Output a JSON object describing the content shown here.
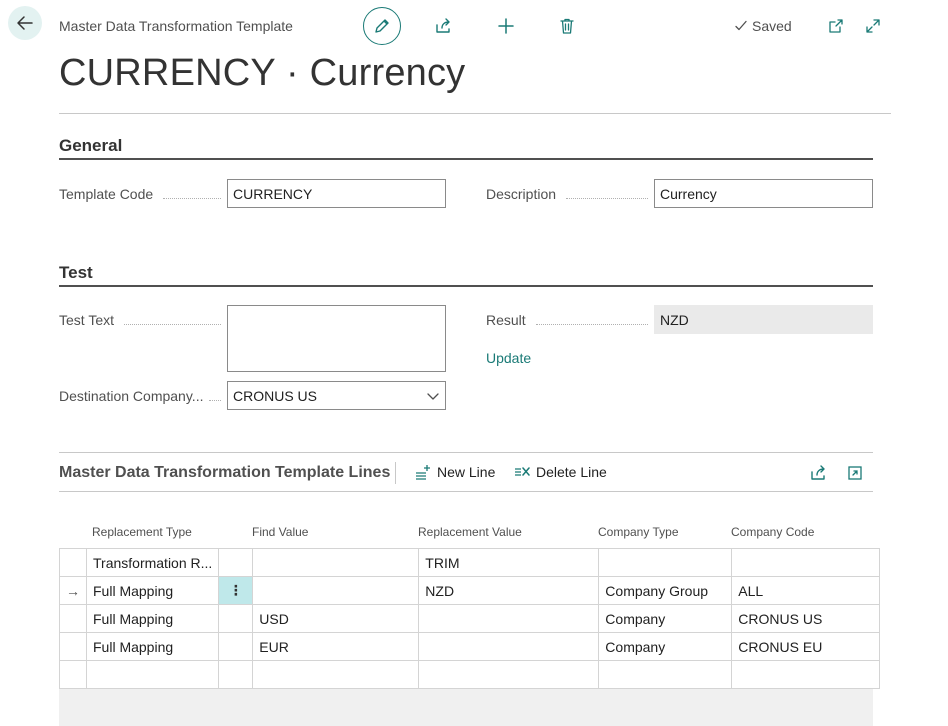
{
  "header": {
    "breadcrumb": "Master Data Transformation Template",
    "saved_label": "Saved",
    "title": "CURRENCY · Currency"
  },
  "general": {
    "heading": "General",
    "template_code_label": "Template Code",
    "template_code_value": "CURRENCY",
    "description_label": "Description",
    "description_value": "Currency"
  },
  "test": {
    "heading": "Test",
    "test_text_label": "Test Text",
    "test_text_value": "",
    "result_label": "Result",
    "result_value": "NZD",
    "update_label": "Update",
    "destination_label": "Destination Company...",
    "destination_value": "CRONUS US"
  },
  "lines": {
    "title": "Master Data Transformation Template Lines",
    "new_line_label": "New Line",
    "delete_line_label": "Delete Line",
    "columns": [
      "Replacement Type",
      "Find Value",
      "Replacement Value",
      "Company Type",
      "Company Code"
    ],
    "rows": [
      {
        "replacement_type": "Transformation R...",
        "find_value": "",
        "replacement_value": "TRIM",
        "company_type": "",
        "company_code": ""
      },
      {
        "replacement_type": "Full Mapping",
        "find_value": "",
        "replacement_value": "NZD",
        "company_type": "Company Group",
        "company_code": "ALL"
      },
      {
        "replacement_type": "Full Mapping",
        "find_value": "USD",
        "replacement_value": "",
        "company_type": "Company",
        "company_code": "CRONUS US"
      },
      {
        "replacement_type": "Full Mapping",
        "find_value": "EUR",
        "replacement_value": "",
        "company_type": "Company",
        "company_code": "CRONUS EU"
      },
      {
        "replacement_type": "",
        "find_value": "",
        "replacement_value": "",
        "company_type": "",
        "company_code": ""
      }
    ],
    "row_menu_glyph": "⋮",
    "selected_row_marker": "→"
  },
  "icons": {
    "back": "back-arrow-icon",
    "edit": "pencil-icon",
    "share": "share-icon",
    "add": "plus-icon",
    "delete": "trash-icon",
    "saved": "checkmark-icon",
    "open_new": "open-in-new-window-icon",
    "expand": "expand-icon"
  },
  "colors": {
    "accent": "#1a7a76",
    "selected_cell": "#bfe8ea",
    "readonly_bg": "#eaeaea"
  }
}
